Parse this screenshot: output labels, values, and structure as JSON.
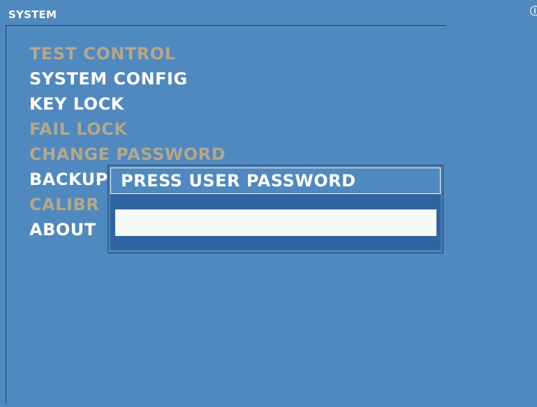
{
  "window": {
    "title": "SYSTEM"
  },
  "menu": {
    "items": [
      {
        "label": "TEST CONTROL",
        "enabled": false
      },
      {
        "label": "SYSTEM CONFIG",
        "enabled": true
      },
      {
        "label": "KEY LOCK",
        "enabled": true
      },
      {
        "label": "FAIL LOCK",
        "enabled": false
      },
      {
        "label": "CHANGE PASSWORD",
        "enabled": false
      },
      {
        "label": "BACKUP",
        "enabled": true
      },
      {
        "label": "CALIBR",
        "enabled": false
      },
      {
        "label": "ABOUT",
        "enabled": true
      }
    ]
  },
  "dialog": {
    "title": "PRESS USER PASSWORD",
    "password_value": ""
  },
  "colors": {
    "background": "#4f89c0",
    "enabled_text": "#ffffff",
    "disabled_text": "#b5a78a",
    "dialog_body": "#2e64a0",
    "input_bg": "#f5faf7"
  },
  "icons": {
    "corner": "info-icon"
  }
}
